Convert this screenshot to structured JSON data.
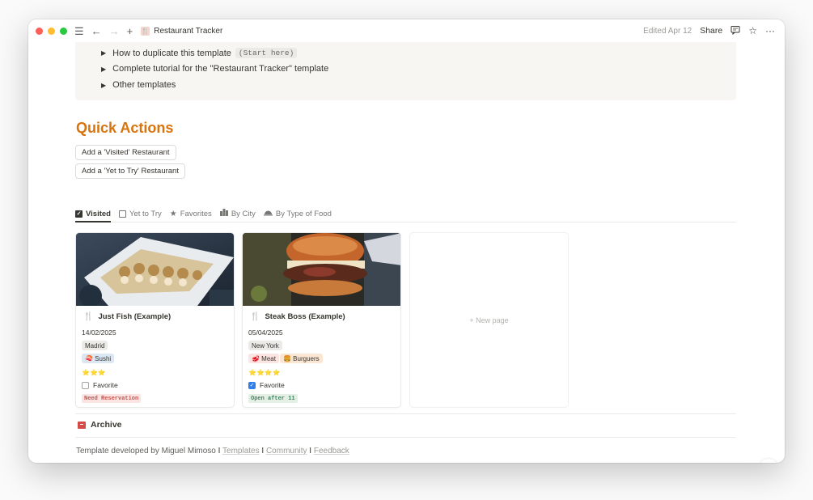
{
  "titlebar": {
    "page_title": "Restaurant Tracker",
    "edited": "Edited Apr 12",
    "share": "Share"
  },
  "callout": {
    "toggles": [
      {
        "label": "How to duplicate this template",
        "code": "(Start here)"
      },
      {
        "label": "Complete tutorial for the \"Restaurant Tracker\" template",
        "code": ""
      },
      {
        "label": "Other templates",
        "code": ""
      }
    ]
  },
  "quick_actions": {
    "heading": "Quick Actions",
    "buttons": [
      "Add a 'Visited' Restaurant",
      "Add a 'Yet to Try' Restaurant"
    ]
  },
  "tabs": [
    {
      "label": "Visited",
      "icon": "checkbox-checked-icon",
      "active": true
    },
    {
      "label": "Yet to Try",
      "icon": "checkbox-empty-icon",
      "active": false
    },
    {
      "label": "Favorites",
      "icon": "star-icon",
      "active": false
    },
    {
      "label": "By City",
      "icon": "city-icon",
      "active": false
    },
    {
      "label": "By Type of Food",
      "icon": "food-cover-icon",
      "active": false
    }
  ],
  "cards": [
    {
      "title": "Just Fish (Example)",
      "date": "14/02/2025",
      "city": "Madrid",
      "food_tags": [
        "🍣 Sushi"
      ],
      "stars": "⭐⭐⭐",
      "favorite_label": "Favorite",
      "favorite": false,
      "status": "Need Reservation"
    },
    {
      "title": "Steak Boss (Example)",
      "date": "05/04/2025",
      "city": "New York",
      "food_tags": [
        "🥩 Meat",
        "🍔 Burguers"
      ],
      "stars": "⭐⭐⭐⭐",
      "favorite_label": "Favorite",
      "favorite": true,
      "status": "Open after 11"
    }
  ],
  "new_page": "+ New page",
  "archive": "Archive",
  "footer": {
    "prefix": "Template developed by Miguel Mimoso",
    "sep": " I ",
    "links": [
      "Templates",
      "Community",
      "Feedback"
    ]
  },
  "help_button": "?",
  "colors": {
    "heading": "#d9730d",
    "checkbox_on": "#2f80ed",
    "archive_icon": "#d44c47"
  }
}
